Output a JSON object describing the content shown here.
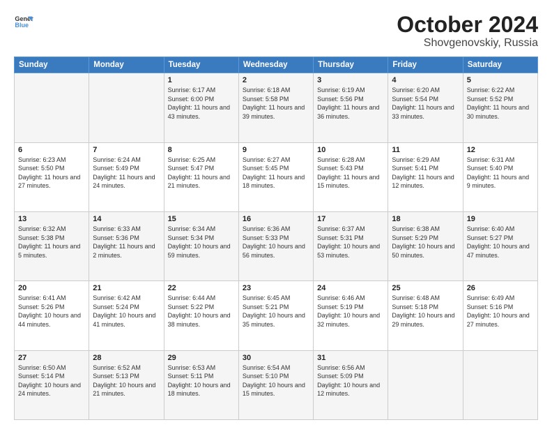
{
  "logo": {
    "line1": "General",
    "line2": "Blue"
  },
  "title": "October 2024",
  "subtitle": "Shovgenovskiy, Russia",
  "days_of_week": [
    "Sunday",
    "Monday",
    "Tuesday",
    "Wednesday",
    "Thursday",
    "Friday",
    "Saturday"
  ],
  "weeks": [
    [
      {
        "day": "",
        "sunrise": "",
        "sunset": "",
        "daylight": ""
      },
      {
        "day": "",
        "sunrise": "",
        "sunset": "",
        "daylight": ""
      },
      {
        "day": "1",
        "sunrise": "Sunrise: 6:17 AM",
        "sunset": "Sunset: 6:00 PM",
        "daylight": "Daylight: 11 hours and 43 minutes."
      },
      {
        "day": "2",
        "sunrise": "Sunrise: 6:18 AM",
        "sunset": "Sunset: 5:58 PM",
        "daylight": "Daylight: 11 hours and 39 minutes."
      },
      {
        "day": "3",
        "sunrise": "Sunrise: 6:19 AM",
        "sunset": "Sunset: 5:56 PM",
        "daylight": "Daylight: 11 hours and 36 minutes."
      },
      {
        "day": "4",
        "sunrise": "Sunrise: 6:20 AM",
        "sunset": "Sunset: 5:54 PM",
        "daylight": "Daylight: 11 hours and 33 minutes."
      },
      {
        "day": "5",
        "sunrise": "Sunrise: 6:22 AM",
        "sunset": "Sunset: 5:52 PM",
        "daylight": "Daylight: 11 hours and 30 minutes."
      }
    ],
    [
      {
        "day": "6",
        "sunrise": "Sunrise: 6:23 AM",
        "sunset": "Sunset: 5:50 PM",
        "daylight": "Daylight: 11 hours and 27 minutes."
      },
      {
        "day": "7",
        "sunrise": "Sunrise: 6:24 AM",
        "sunset": "Sunset: 5:49 PM",
        "daylight": "Daylight: 11 hours and 24 minutes."
      },
      {
        "day": "8",
        "sunrise": "Sunrise: 6:25 AM",
        "sunset": "Sunset: 5:47 PM",
        "daylight": "Daylight: 11 hours and 21 minutes."
      },
      {
        "day": "9",
        "sunrise": "Sunrise: 6:27 AM",
        "sunset": "Sunset: 5:45 PM",
        "daylight": "Daylight: 11 hours and 18 minutes."
      },
      {
        "day": "10",
        "sunrise": "Sunrise: 6:28 AM",
        "sunset": "Sunset: 5:43 PM",
        "daylight": "Daylight: 11 hours and 15 minutes."
      },
      {
        "day": "11",
        "sunrise": "Sunrise: 6:29 AM",
        "sunset": "Sunset: 5:41 PM",
        "daylight": "Daylight: 11 hours and 12 minutes."
      },
      {
        "day": "12",
        "sunrise": "Sunrise: 6:31 AM",
        "sunset": "Sunset: 5:40 PM",
        "daylight": "Daylight: 11 hours and 9 minutes."
      }
    ],
    [
      {
        "day": "13",
        "sunrise": "Sunrise: 6:32 AM",
        "sunset": "Sunset: 5:38 PM",
        "daylight": "Daylight: 11 hours and 5 minutes."
      },
      {
        "day": "14",
        "sunrise": "Sunrise: 6:33 AM",
        "sunset": "Sunset: 5:36 PM",
        "daylight": "Daylight: 11 hours and 2 minutes."
      },
      {
        "day": "15",
        "sunrise": "Sunrise: 6:34 AM",
        "sunset": "Sunset: 5:34 PM",
        "daylight": "Daylight: 10 hours and 59 minutes."
      },
      {
        "day": "16",
        "sunrise": "Sunrise: 6:36 AM",
        "sunset": "Sunset: 5:33 PM",
        "daylight": "Daylight: 10 hours and 56 minutes."
      },
      {
        "day": "17",
        "sunrise": "Sunrise: 6:37 AM",
        "sunset": "Sunset: 5:31 PM",
        "daylight": "Daylight: 10 hours and 53 minutes."
      },
      {
        "day": "18",
        "sunrise": "Sunrise: 6:38 AM",
        "sunset": "Sunset: 5:29 PM",
        "daylight": "Daylight: 10 hours and 50 minutes."
      },
      {
        "day": "19",
        "sunrise": "Sunrise: 6:40 AM",
        "sunset": "Sunset: 5:27 PM",
        "daylight": "Daylight: 10 hours and 47 minutes."
      }
    ],
    [
      {
        "day": "20",
        "sunrise": "Sunrise: 6:41 AM",
        "sunset": "Sunset: 5:26 PM",
        "daylight": "Daylight: 10 hours and 44 minutes."
      },
      {
        "day": "21",
        "sunrise": "Sunrise: 6:42 AM",
        "sunset": "Sunset: 5:24 PM",
        "daylight": "Daylight: 10 hours and 41 minutes."
      },
      {
        "day": "22",
        "sunrise": "Sunrise: 6:44 AM",
        "sunset": "Sunset: 5:22 PM",
        "daylight": "Daylight: 10 hours and 38 minutes."
      },
      {
        "day": "23",
        "sunrise": "Sunrise: 6:45 AM",
        "sunset": "Sunset: 5:21 PM",
        "daylight": "Daylight: 10 hours and 35 minutes."
      },
      {
        "day": "24",
        "sunrise": "Sunrise: 6:46 AM",
        "sunset": "Sunset: 5:19 PM",
        "daylight": "Daylight: 10 hours and 32 minutes."
      },
      {
        "day": "25",
        "sunrise": "Sunrise: 6:48 AM",
        "sunset": "Sunset: 5:18 PM",
        "daylight": "Daylight: 10 hours and 29 minutes."
      },
      {
        "day": "26",
        "sunrise": "Sunrise: 6:49 AM",
        "sunset": "Sunset: 5:16 PM",
        "daylight": "Daylight: 10 hours and 27 minutes."
      }
    ],
    [
      {
        "day": "27",
        "sunrise": "Sunrise: 6:50 AM",
        "sunset": "Sunset: 5:14 PM",
        "daylight": "Daylight: 10 hours and 24 minutes."
      },
      {
        "day": "28",
        "sunrise": "Sunrise: 6:52 AM",
        "sunset": "Sunset: 5:13 PM",
        "daylight": "Daylight: 10 hours and 21 minutes."
      },
      {
        "day": "29",
        "sunrise": "Sunrise: 6:53 AM",
        "sunset": "Sunset: 5:11 PM",
        "daylight": "Daylight: 10 hours and 18 minutes."
      },
      {
        "day": "30",
        "sunrise": "Sunrise: 6:54 AM",
        "sunset": "Sunset: 5:10 PM",
        "daylight": "Daylight: 10 hours and 15 minutes."
      },
      {
        "day": "31",
        "sunrise": "Sunrise: 6:56 AM",
        "sunset": "Sunset: 5:09 PM",
        "daylight": "Daylight: 10 hours and 12 minutes."
      },
      {
        "day": "",
        "sunrise": "",
        "sunset": "",
        "daylight": ""
      },
      {
        "day": "",
        "sunrise": "",
        "sunset": "",
        "daylight": ""
      }
    ]
  ]
}
